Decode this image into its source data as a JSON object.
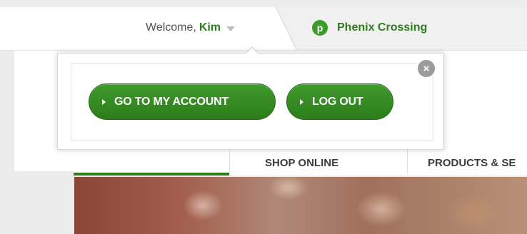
{
  "header": {
    "welcome_text": "Welcome,",
    "user_name": "Kim",
    "store_icon_letter": "p",
    "store_name": "Phenix Crossing"
  },
  "account_popup": {
    "go_to_account_label": "GO TO MY ACCOUNT",
    "log_out_label": "LOG OUT",
    "close_symbol": "×"
  },
  "nav": {
    "shop_online_label": "SHOP ONLINE",
    "products_label": "PRODUCTS & SE"
  },
  "colors": {
    "brand_green": "#2f7d1e",
    "button_green": "#3f9a2c",
    "close_gray": "#9b9b9b"
  },
  "icons": {
    "store": "publix-logo-icon",
    "dropdown": "caret-down-icon",
    "close": "close-icon",
    "button_arrow": "caret-right-icon"
  }
}
